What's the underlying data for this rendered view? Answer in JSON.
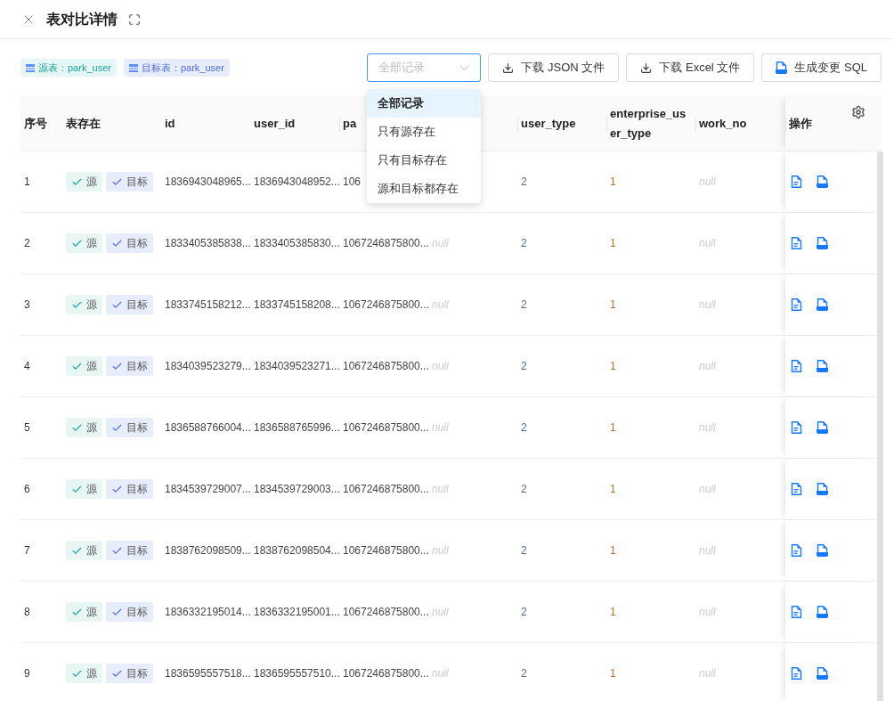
{
  "dialog": {
    "title": "表对比详情"
  },
  "tables": [
    {
      "kind": "source",
      "label": "源表：park_user"
    },
    {
      "kind": "target",
      "label": "目标表：park_user"
    }
  ],
  "filter": {
    "placeholder": "全部记录",
    "open": true,
    "options": [
      {
        "label": "全部记录",
        "selected": true
      },
      {
        "label": "只有源存在",
        "selected": false
      },
      {
        "label": "只有目标存在",
        "selected": false
      },
      {
        "label": "源和目标都存在",
        "selected": false
      }
    ]
  },
  "actions": [
    {
      "kind": "download",
      "label": "下载 JSON 文件"
    },
    {
      "kind": "download",
      "label": "下载 Excel 文件"
    },
    {
      "kind": "sql",
      "label": "生成变更 SQL"
    }
  ],
  "table": {
    "columns": [
      {
        "label": "序号"
      },
      {
        "label": "表存在"
      },
      {
        "label": "id"
      },
      {
        "label": "user_id"
      },
      {
        "label": "pa"
      },
      {},
      {
        "label": "user_type"
      },
      {
        "label": "enterprise_user_type"
      },
      {
        "label": "work_no"
      },
      {
        "label": "操作"
      }
    ],
    "rows": [
      {
        "index": "1",
        "source_label": "源",
        "target_label": "目标",
        "id": "1836943048965...",
        "user_id": "1836943048952...",
        "column_5": "106",
        "user_type": "2",
        "enterprise_user_type": "1",
        "work_no": "null"
      },
      {
        "index": "2",
        "source_label": "源",
        "target_label": "目标",
        "id": "1833405385838...",
        "user_id": "1833405385830...",
        "column_5": "1067246875800...",
        "column_6": "null",
        "user_type": "2",
        "enterprise_user_type": "1",
        "work_no": "null"
      },
      {
        "index": "3",
        "source_label": "源",
        "target_label": "目标",
        "id": "1833745158212...",
        "user_id": "1833745158208...",
        "column_5": "1067246875800...",
        "column_6": "null",
        "user_type": "2",
        "enterprise_user_type": "1",
        "work_no": "null"
      },
      {
        "index": "4",
        "source_label": "源",
        "target_label": "目标",
        "id": "1834039523279...",
        "user_id": "1834039523271...",
        "column_5": "1067246875800...",
        "column_6": "null",
        "user_type": "2",
        "enterprise_user_type": "1",
        "work_no": "null"
      },
      {
        "index": "5",
        "source_label": "源",
        "target_label": "目标",
        "id": "1836588766004...",
        "user_id": "1836588765996...",
        "column_5": "1067246875800...",
        "column_6": "null",
        "user_type": "2",
        "enterprise_user_type": "1",
        "work_no": "null"
      },
      {
        "index": "6",
        "source_label": "源",
        "target_label": "目标",
        "id": "1834539729007...",
        "user_id": "1834539729003...",
        "column_5": "1067246875800...",
        "column_6": "null",
        "user_type": "2",
        "enterprise_user_type": "1",
        "work_no": "null"
      },
      {
        "index": "7",
        "source_label": "源",
        "target_label": "目标",
        "id": "1838762098509...",
        "user_id": "1838762098504...",
        "column_5": "1067246875800...",
        "column_6": "null",
        "user_type": "2",
        "enterprise_user_type": "1",
        "work_no": "null"
      },
      {
        "index": "8",
        "source_label": "源",
        "target_label": "目标",
        "id": "1836332195014...",
        "user_id": "1836332195001...",
        "column_5": "1067246875800...",
        "column_6": "null",
        "user_type": "2",
        "enterprise_user_type": "1",
        "work_no": "null"
      },
      {
        "index": "9",
        "source_label": "源",
        "target_label": "目标",
        "id": "1836595557518...",
        "user_id": "1836595557510...",
        "column_5": "1067246875800...",
        "column_6": "null",
        "user_type": "2",
        "enterprise_user_type": "1",
        "work_no": "null"
      }
    ]
  }
}
